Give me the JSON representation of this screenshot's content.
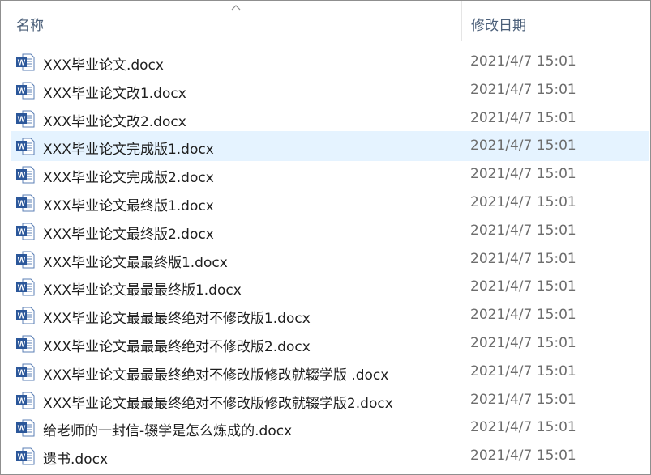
{
  "header": {
    "name_label": "名称",
    "date_label": "修改日期"
  },
  "icons": {
    "sort": "chevron-up-icon",
    "file": "word-document-icon"
  },
  "colors": {
    "selected_row": "#e5f3ff",
    "header_text": "#4c607a",
    "word_blue": "#2b579a"
  },
  "selected_index": 3,
  "files": [
    {
      "name": "XXX毕业论文.docx",
      "date": "2021/4/7 15:01"
    },
    {
      "name": "XXX毕业论文改1.docx",
      "date": "2021/4/7 15:01"
    },
    {
      "name": "XXX毕业论文改2.docx",
      "date": "2021/4/7 15:01"
    },
    {
      "name": "XXX毕业论文完成版1.docx",
      "date": "2021/4/7 15:01"
    },
    {
      "name": "XXX毕业论文完成版2.docx",
      "date": "2021/4/7 15:01"
    },
    {
      "name": "XXX毕业论文最终版1.docx",
      "date": "2021/4/7 15:01"
    },
    {
      "name": "XXX毕业论文最终版2.docx",
      "date": "2021/4/7 15:01"
    },
    {
      "name": "XXX毕业论文最最终版1.docx",
      "date": "2021/4/7 15:01"
    },
    {
      "name": "XXX毕业论文最最最终版1.docx",
      "date": "2021/4/7 15:01"
    },
    {
      "name": "XXX毕业论文最最最终绝对不修改版1.docx",
      "date": "2021/4/7 15:01"
    },
    {
      "name": "XXX毕业论文最最最终绝对不修改版2.docx",
      "date": "2021/4/7 15:01"
    },
    {
      "name": "XXX毕业论文最最最终绝对不修改版修改就辍学版 .docx",
      "date": "2021/4/7 15:01"
    },
    {
      "name": "XXX毕业论文最最最终绝对不修改版修改就辍学版2.docx",
      "date": "2021/4/7 15:01"
    },
    {
      "name": "给老师的一封信-辍学是怎么炼成的.docx",
      "date": "2021/4/7 15:01"
    },
    {
      "name": "遗书.docx",
      "date": "2021/4/7 15:01"
    }
  ]
}
